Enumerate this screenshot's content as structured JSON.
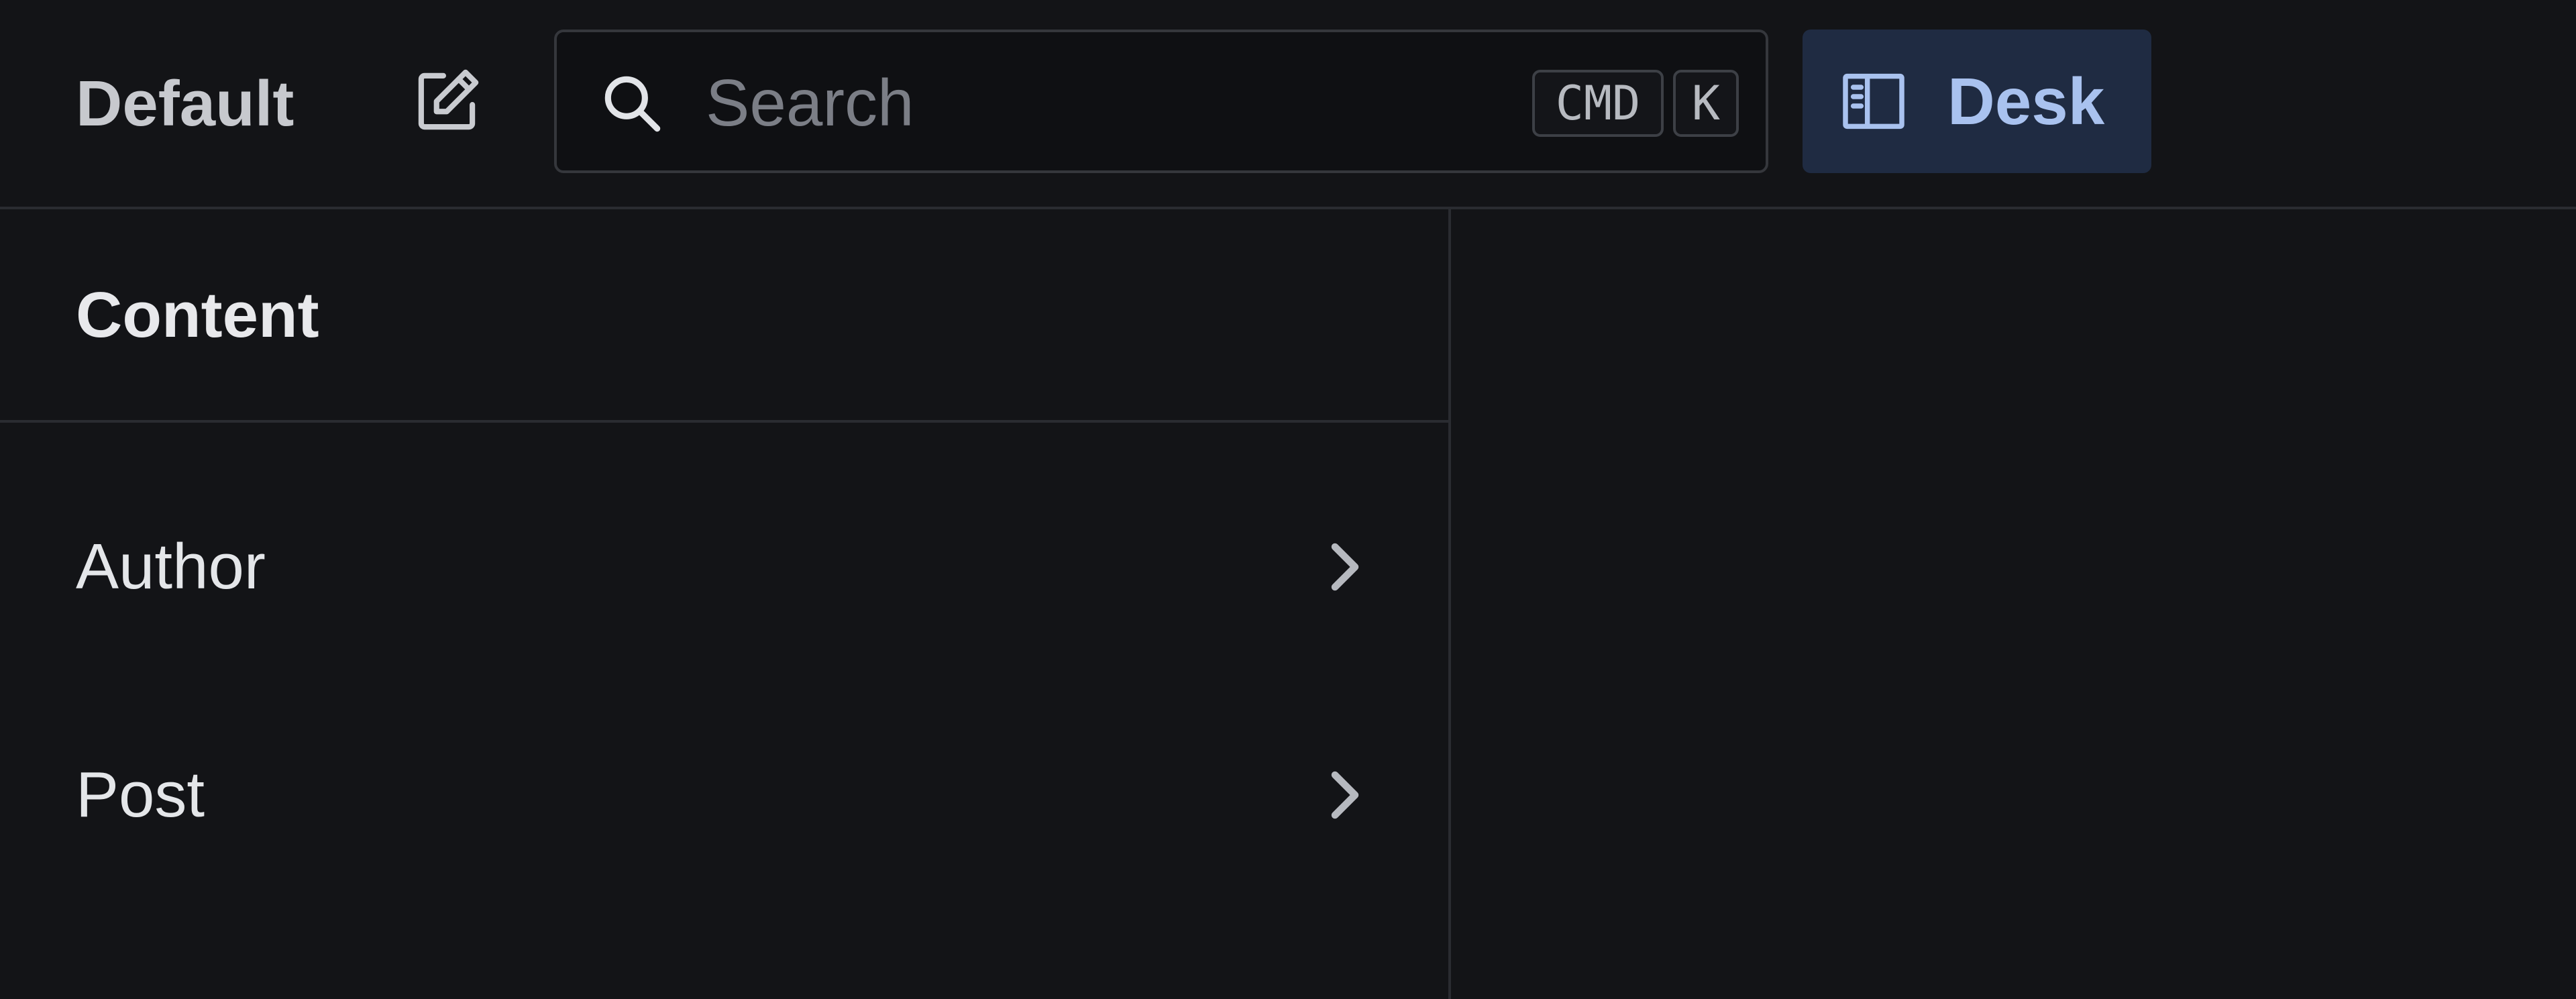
{
  "topbar": {
    "workspace": "Default",
    "edit_icon": "edit-icon",
    "search": {
      "icon": "search-icon",
      "placeholder": "Search",
      "value": "",
      "shortcut_keys": [
        "CMD",
        "K"
      ]
    },
    "desk_button": {
      "icon": "desk-panels-icon",
      "label": "Desk"
    }
  },
  "content_pane": {
    "title": "Content",
    "items": [
      {
        "label": "Author",
        "icon": "chevron-right-icon"
      },
      {
        "label": "Post",
        "icon": "chevron-right-icon"
      }
    ]
  },
  "colors": {
    "background": "#131417",
    "border": "#2a2c31",
    "accent_bg": "#1f2b42",
    "accent_text": "#a9c2ef"
  }
}
